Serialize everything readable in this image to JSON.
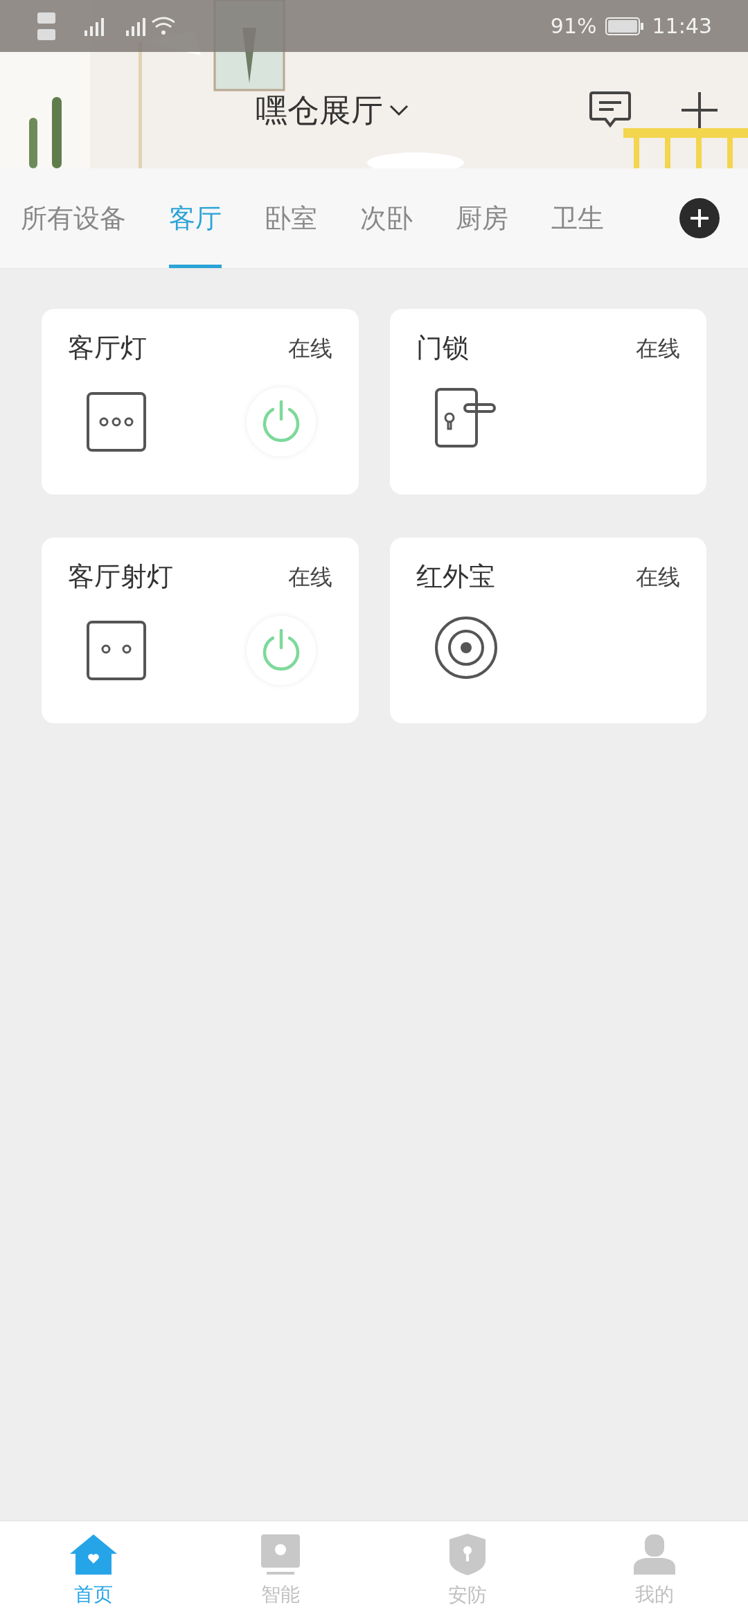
{
  "status_bar": {
    "battery": "91%",
    "time": "11:43"
  },
  "header": {
    "title": "嘿仓展厅"
  },
  "tabs": [
    {
      "label": "所有设备",
      "selected": false
    },
    {
      "label": "客厅",
      "selected": true
    },
    {
      "label": "卧室",
      "selected": false
    },
    {
      "label": "次卧",
      "selected": false
    },
    {
      "label": "厨房",
      "selected": false
    },
    {
      "label": "卫生",
      "selected": false
    }
  ],
  "devices": [
    {
      "name": "客厅灯",
      "status": "在线",
      "kind": "socket3",
      "power_on": true
    },
    {
      "name": "门锁",
      "status": "在线",
      "kind": "lock"
    },
    {
      "name": "客厅射灯",
      "status": "在线",
      "kind": "socket2",
      "power_on": true
    },
    {
      "name": "红外宝",
      "status": "在线",
      "kind": "infrared"
    }
  ],
  "bottom_nav": [
    {
      "label": "首页",
      "kind": "home",
      "selected": true
    },
    {
      "label": "智能",
      "kind": "smart",
      "selected": false
    },
    {
      "label": "安防",
      "kind": "security",
      "selected": false
    },
    {
      "label": "我的",
      "kind": "profile",
      "selected": false
    }
  ]
}
